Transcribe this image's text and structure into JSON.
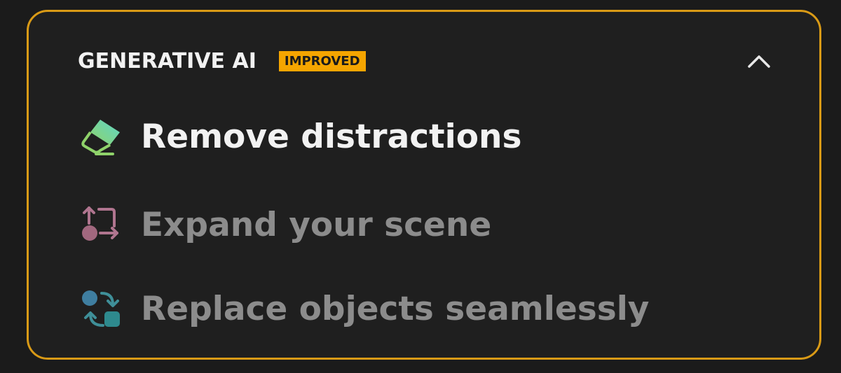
{
  "section": {
    "title": "GENERATIVE AI",
    "badge": "IMPROVED",
    "collapse_icon": "chevron-up-icon"
  },
  "colors": {
    "accent": "#d99a16",
    "badge_bg": "#f5a500",
    "active_text": "#f2f2f2",
    "inactive_text": "#8c8c8c",
    "panel_bg": "#1f1f1f"
  },
  "items": [
    {
      "label": "Remove distractions",
      "icon": "eraser-icon",
      "active": true
    },
    {
      "label": "Expand your scene",
      "icon": "expand-icon",
      "active": false
    },
    {
      "label": "Replace objects seamlessly",
      "icon": "swap-objects-icon",
      "active": false
    }
  ]
}
